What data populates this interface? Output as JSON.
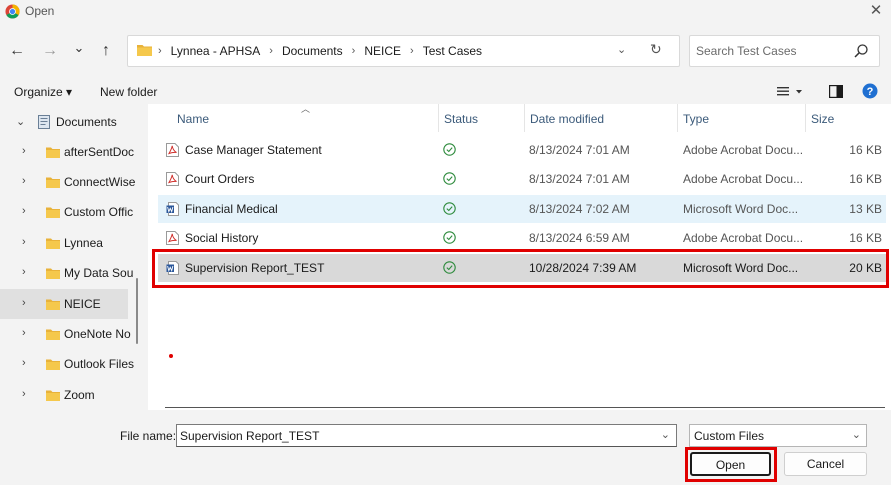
{
  "window": {
    "title": "Open",
    "close_glyph": "✕",
    "app_icon": "chrome-icon"
  },
  "nav": {
    "back_glyph": "←",
    "forward_glyph": "→",
    "recent_glyph": "⌄",
    "up_glyph": "↑"
  },
  "address": {
    "breadcrumb": [
      "Lynnea - APHSA",
      "Documents",
      "NEICE",
      "Test Cases"
    ],
    "separator": "›",
    "dropdown_glyph": "⌄",
    "refresh_glyph": "↻"
  },
  "search": {
    "placeholder": "Search Test Cases"
  },
  "toolbar": {
    "organize_label": "Organize ▾",
    "new_folder_label": "New folder",
    "help_glyph": "?"
  },
  "sidebar": {
    "items": [
      {
        "label": "Documents",
        "expanded": true
      },
      {
        "label": "afterSentDoc"
      },
      {
        "label": "ConnectWise"
      },
      {
        "label": "Custom Offic"
      },
      {
        "label": "Lynnea"
      },
      {
        "label": "My Data Sou"
      },
      {
        "label": "NEICE",
        "selected": true
      },
      {
        "label": "OneNote No"
      },
      {
        "label": "Outlook Files"
      },
      {
        "label": "Zoom"
      }
    ]
  },
  "columns": {
    "name": "Name",
    "status": "Status",
    "date_modified": "Date modified",
    "type": "Type",
    "size": "Size"
  },
  "files": [
    {
      "name": "Case Manager Statement",
      "icon": "pdf-icon",
      "status": "synced",
      "date": "8/13/2024 7:01 AM",
      "type": "Adobe Acrobat Docu...",
      "size": "16 KB"
    },
    {
      "name": "Court Orders",
      "icon": "pdf-icon",
      "status": "synced",
      "date": "8/13/2024 7:01 AM",
      "type": "Adobe Acrobat Docu...",
      "size": "16 KB"
    },
    {
      "name": "Financial Medical",
      "icon": "word-icon",
      "status": "synced",
      "date": "8/13/2024 7:02 AM",
      "type": "Microsoft Word Doc...",
      "size": "13 KB"
    },
    {
      "name": "Social History",
      "icon": "pdf-icon",
      "status": "synced",
      "date": "8/13/2024 6:59 AM",
      "type": "Adobe Acrobat Docu...",
      "size": "16 KB"
    },
    {
      "name": "Supervision Report_TEST",
      "icon": "word-icon",
      "status": "synced",
      "date": "10/28/2024 7:39 AM",
      "type": "Microsoft Word Doc...",
      "size": "20 KB"
    }
  ],
  "footer": {
    "filename_label": "File name:",
    "filename_value": "Supervision Report_TEST",
    "filter_value": "Custom Files",
    "open_label": "Open",
    "cancel_label": "Cancel"
  },
  "colors": {
    "highlight": "#e00000",
    "selected_row": "#d9d9d9",
    "hover_row": "#e5f3fb",
    "folder": "#f2c14e",
    "pdf": "#d0312d",
    "word": "#2b579a",
    "status_ok": "#2e8b3d"
  }
}
